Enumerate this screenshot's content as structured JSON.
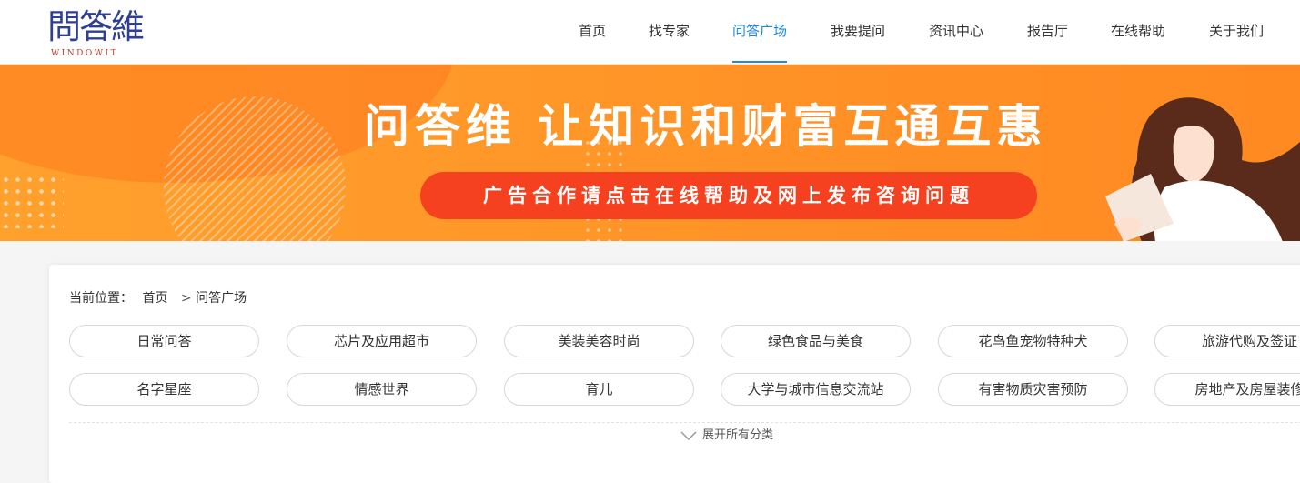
{
  "logo": {
    "cn": "問答維",
    "en": "WINDOWIT"
  },
  "nav": [
    "首页",
    "找专家",
    "问答广场",
    "我要提问",
    "资讯中心",
    "报告厅",
    "在线帮助",
    "关于我们"
  ],
  "nav_active": "问答广场",
  "banner": {
    "title": "问答维 让知识和财富互通互惠",
    "pill": "广告合作请点击在线帮助及网上发布咨询问题"
  },
  "breadcrumb": {
    "label": "当前位置：",
    "home": "首页",
    "separator": ">",
    "current": "问答广场"
  },
  "categories": [
    "日常问答",
    "芯片及应用超市",
    "美装美容时尚",
    "绿色食品与美食",
    "花鸟鱼宠物特种犬",
    "旅游代购及签证",
    "名字星座",
    "情感世界",
    "育儿",
    "大学与城市信息交流站",
    "有害物质灾害预防",
    "房地产及房屋装修"
  ],
  "expand_label": "展开所有分类",
  "colors": {
    "accent": "#1e88e5",
    "banner": "#ff9a2a",
    "pill": "#f5411f",
    "logo": "#2f3f92"
  }
}
